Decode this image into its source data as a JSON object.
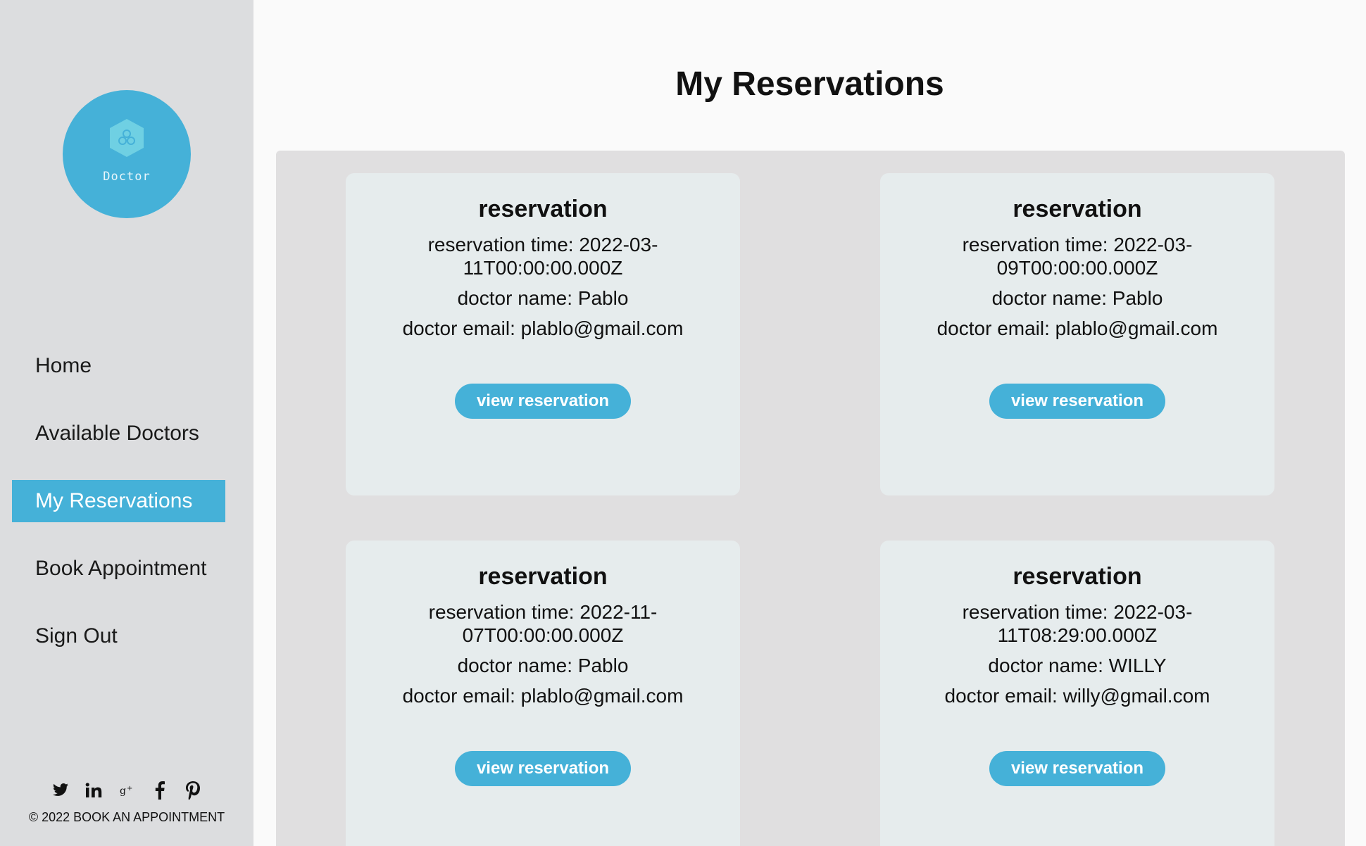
{
  "logo": {
    "text": "Doctor",
    "icon": "hexagon-logo-icon"
  },
  "nav": {
    "items": [
      {
        "label": "Home",
        "active": false
      },
      {
        "label": "Available Doctors",
        "active": false
      },
      {
        "label": "My Reservations",
        "active": true
      },
      {
        "label": "Book Appointment",
        "active": false
      },
      {
        "label": "Sign Out",
        "active": false
      }
    ]
  },
  "footer": {
    "social": [
      "twitter-icon",
      "linkedin-icon",
      "google-plus-icon",
      "facebook-icon",
      "pinterest-icon"
    ],
    "copyright": "© 2022 BOOK AN APPOINTMENT"
  },
  "page": {
    "title": "My Reservations"
  },
  "reservations": [
    {
      "title": "reservation",
      "time": "reservation time: 2022-03-11T00:00:00.000Z",
      "doctor_name": "doctor name: Pablo",
      "doctor_email": "doctor email: plablo@gmail.com",
      "button": "view reservation"
    },
    {
      "title": "reservation",
      "time": "reservation time: 2022-03-09T00:00:00.000Z",
      "doctor_name": "doctor name: Pablo",
      "doctor_email": "doctor email: plablo@gmail.com",
      "button": "view reservation"
    },
    {
      "title": "reservation",
      "time": "reservation time: 2022-11-07T00:00:00.000Z",
      "doctor_name": "doctor name: Pablo",
      "doctor_email": "doctor email: plablo@gmail.com",
      "button": "view reservation"
    },
    {
      "title": "reservation",
      "time": "reservation time: 2022-03-11T08:29:00.000Z",
      "doctor_name": "doctor name: WILLY",
      "doctor_email": "doctor email: willy@gmail.com",
      "button": "view reservation"
    }
  ],
  "colors": {
    "accent": "#45b1d8",
    "sidebar": "#dcdddf",
    "board": "#e0dfe0",
    "card": "#e6eced"
  }
}
